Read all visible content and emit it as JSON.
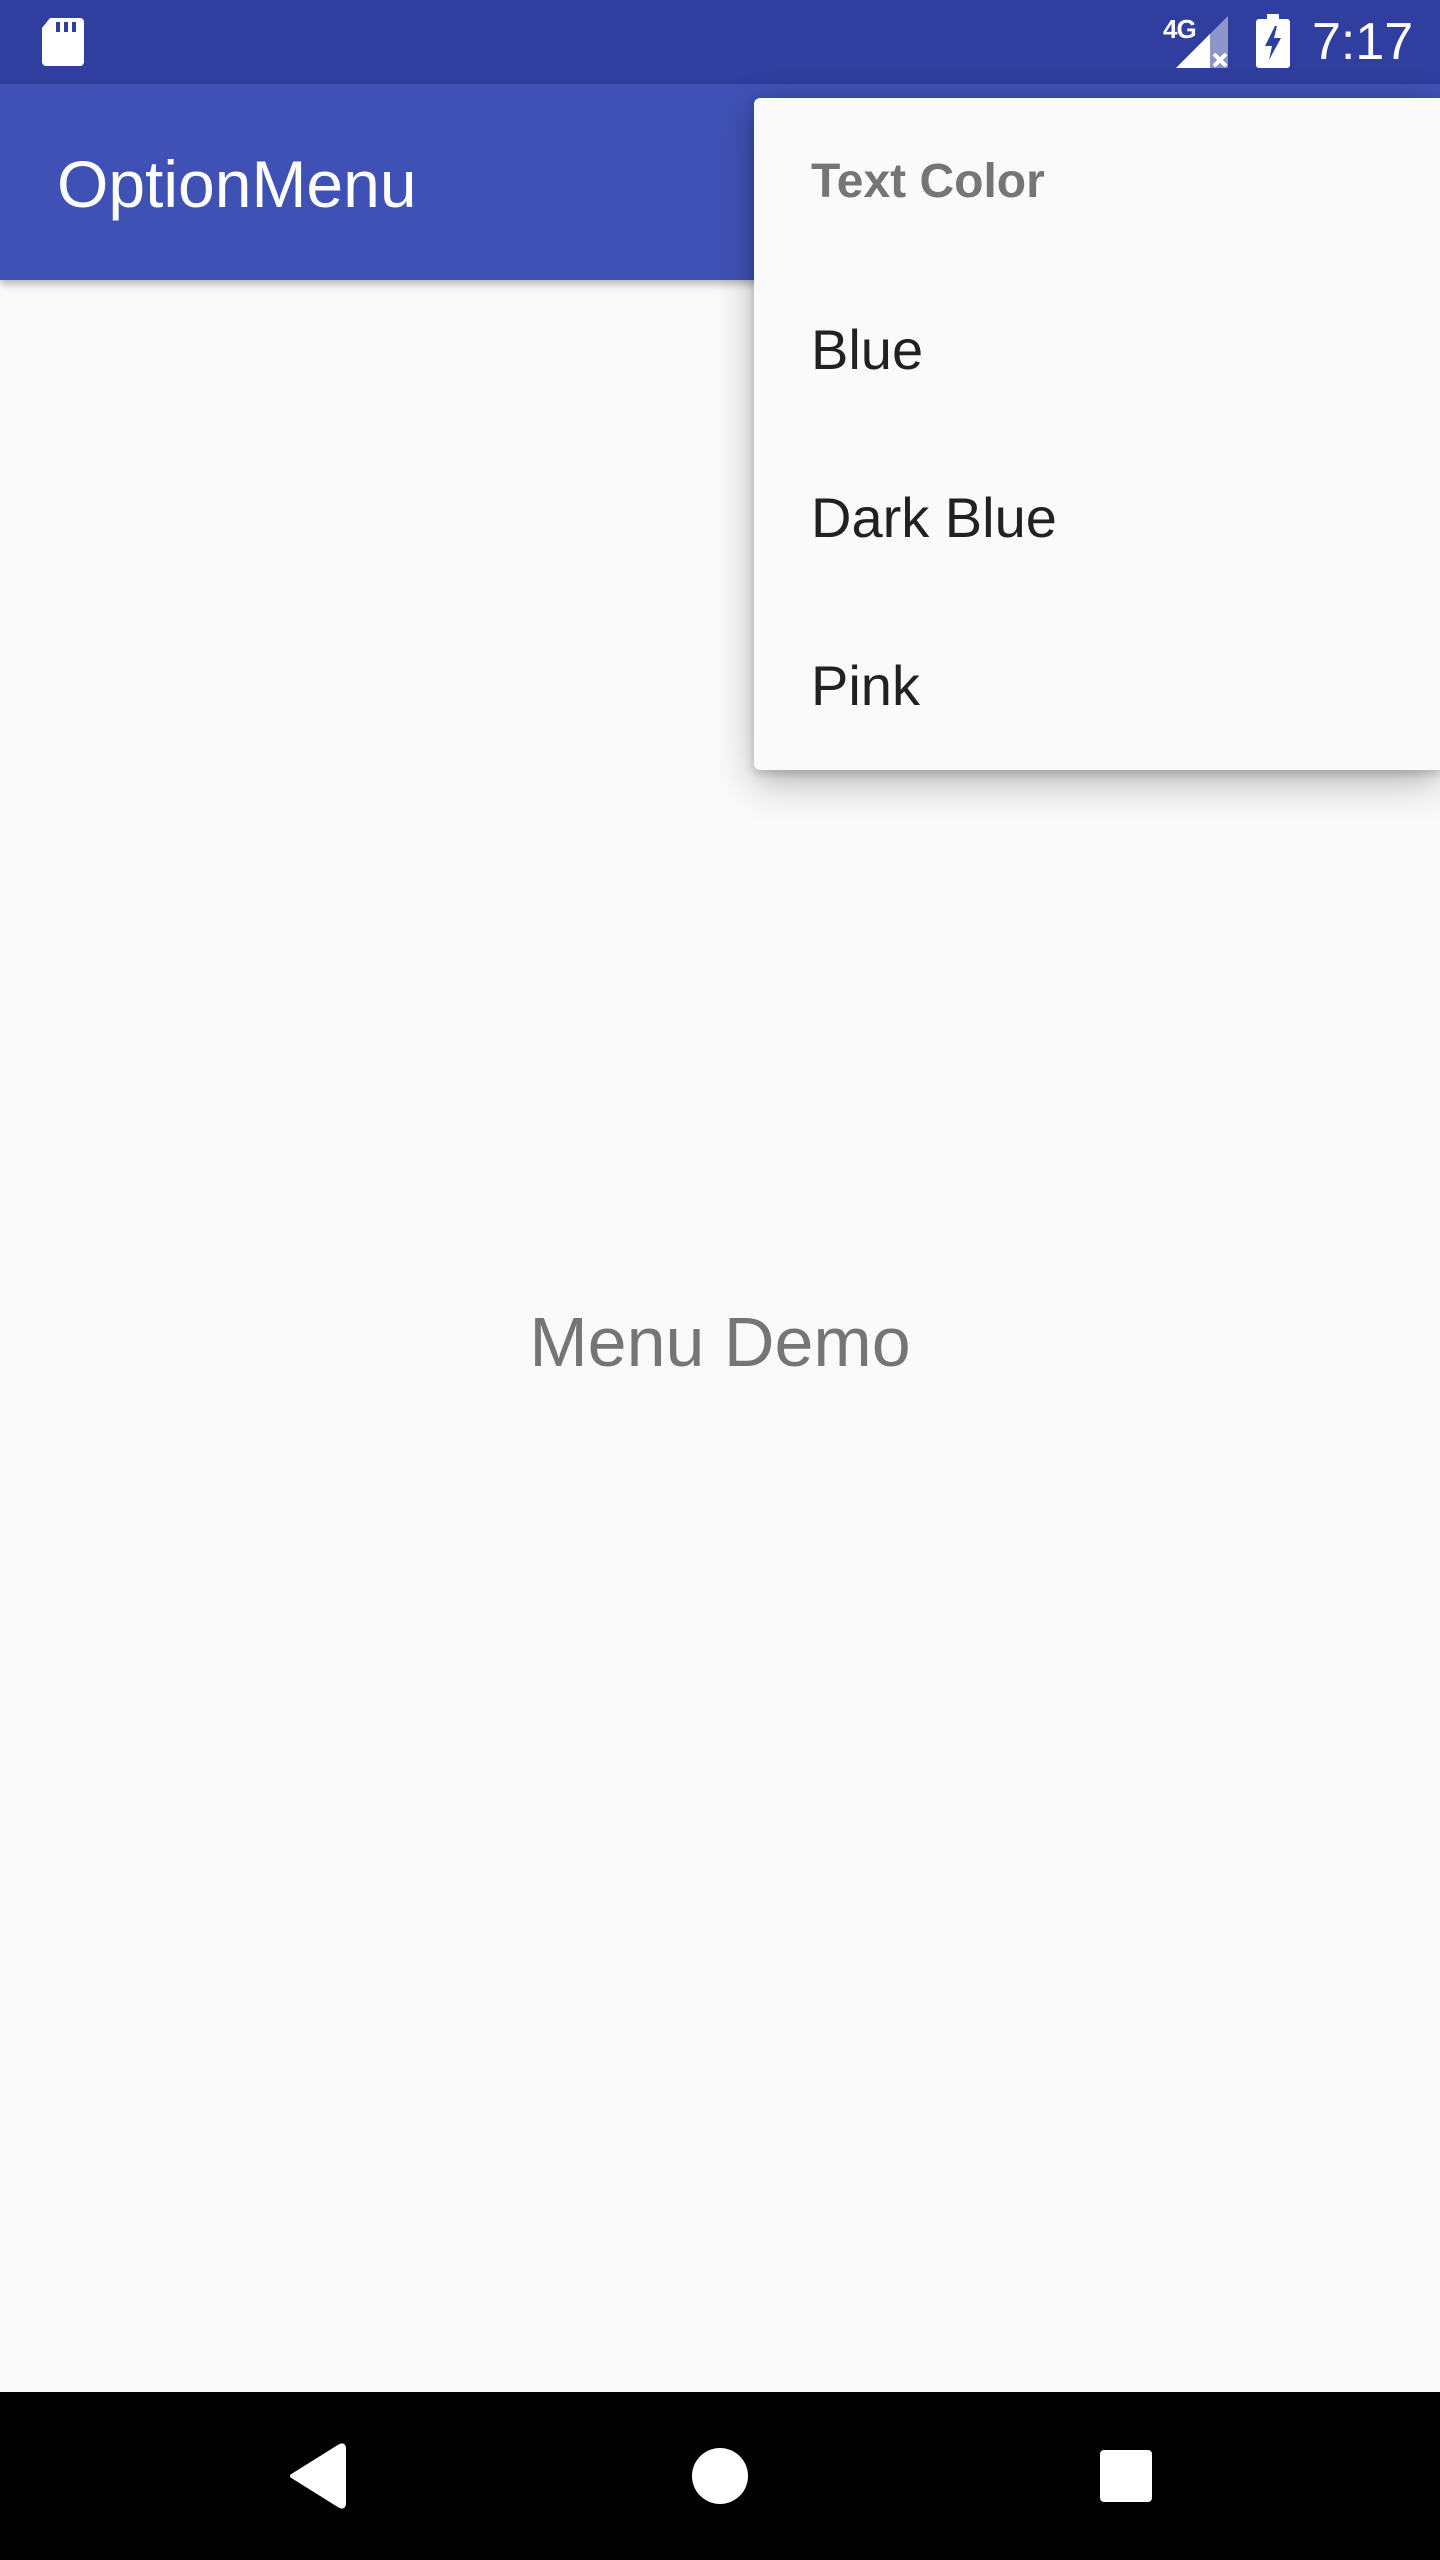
{
  "status_bar": {
    "time": "7:17",
    "network_type": "4G",
    "icons": [
      "sd-card-icon",
      "signal-no-data-icon",
      "battery-charging-icon"
    ]
  },
  "app_bar": {
    "title": "OptionMenu"
  },
  "content": {
    "text": "Menu Demo"
  },
  "popup_menu": {
    "header": "Text Color",
    "items": [
      {
        "label": "Blue"
      },
      {
        "label": "Dark Blue"
      },
      {
        "label": "Pink"
      }
    ]
  },
  "nav_bar": {
    "icons": [
      "back-icon",
      "home-icon",
      "recents-icon"
    ]
  },
  "colors": {
    "status_bar": "#303f9f",
    "app_bar": "#3f51b5",
    "background": "#fafafa",
    "menu_text": "#212121",
    "secondary_text": "#757575"
  }
}
